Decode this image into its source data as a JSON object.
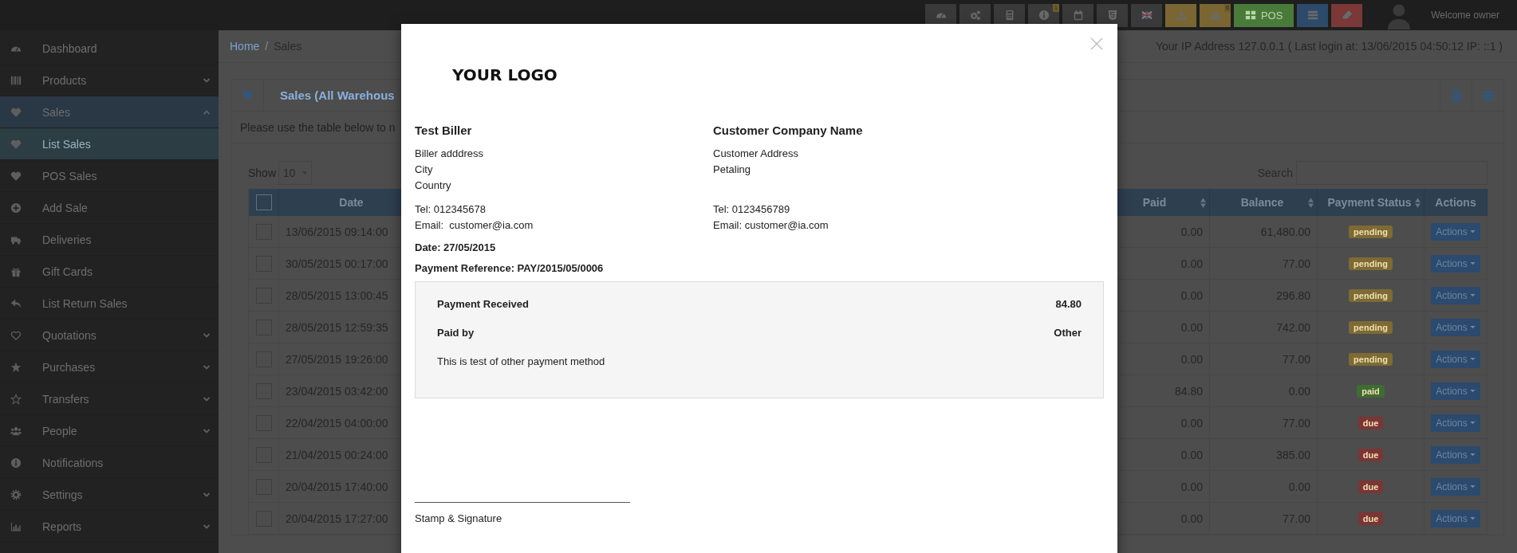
{
  "topbar": {
    "buttons": [
      {
        "color": "#3a3a3a"
      },
      {
        "color": "#3a3a3a"
      },
      {
        "color": "#3a3a3a"
      },
      {
        "color": "#3a3a3a",
        "badge": "1"
      },
      {
        "color": "#3a3a3a"
      },
      {
        "color": "#3a3a3a"
      },
      {
        "color": "#3a3a3a"
      },
      {
        "color": "#7a6633"
      },
      {
        "color": "#7a6633",
        "badge": "6"
      },
      {
        "color": "#4a7a3a",
        "label": "POS"
      },
      {
        "color": "#2e4a6a"
      },
      {
        "color": "#7a3838"
      }
    ],
    "welcome": "Welcome owner"
  },
  "sidebar": {
    "items": [
      {
        "label": "Dashboard",
        "selected": false
      },
      {
        "label": "Products",
        "selected": false,
        "expanded": false
      },
      {
        "label": "Sales",
        "selected": true,
        "expanded": true,
        "children": [
          {
            "label": "List Sales",
            "selected": true
          },
          {
            "label": "POS Sales",
            "selected": false
          },
          {
            "label": "Add Sale",
            "selected": false
          },
          {
            "label": "Deliveries",
            "selected": false
          },
          {
            "label": "Gift Cards",
            "selected": false
          },
          {
            "label": "List Return Sales",
            "selected": false
          }
        ]
      },
      {
        "label": "Quotations",
        "selected": false,
        "expanded": false
      },
      {
        "label": "Purchases",
        "selected": false,
        "expanded": false
      },
      {
        "label": "Transfers",
        "selected": false,
        "expanded": false
      },
      {
        "label": "People",
        "selected": false,
        "expanded": false
      },
      {
        "label": "Notifications",
        "selected": false
      },
      {
        "label": "Settings",
        "selected": false,
        "expanded": false
      },
      {
        "label": "Reports",
        "selected": false,
        "expanded": false
      }
    ]
  },
  "breadcrumb": {
    "items": [
      "Home",
      "Sales"
    ],
    "separator": "/"
  },
  "ip_info": "Your IP Address 127.0.0.1 ( Last login at: 13/06/2015 04:50:12 IP: ::1 )",
  "panel": {
    "title": "Sales (All Warehous",
    "intro": "Please use the table below to n"
  },
  "table": {
    "show_label": "Show",
    "page_size": "10",
    "search_label": "Search",
    "header_checked": false,
    "columns": [
      {
        "label": "Date",
        "sortable": false
      },
      {
        "label": "Paid",
        "sortable": true
      },
      {
        "label": "Balance",
        "sortable": true
      },
      {
        "label": "Payment Status",
        "sortable": true
      },
      {
        "label": "Actions",
        "sortable": false
      }
    ],
    "rows": [
      {
        "checked": false,
        "date": "13/06/2015 09:14:00",
        "paid": "0.00",
        "balance": "61,480.00",
        "status": {
          "label": "pending",
          "color": "#7d6a35"
        },
        "action": "Actions"
      },
      {
        "checked": false,
        "date": "30/05/2015 00:17:00",
        "paid": "0.00",
        "balance": "77.00",
        "status": {
          "label": "pending",
          "color": "#7d6a35"
        },
        "action": "Actions"
      },
      {
        "checked": false,
        "date": "28/05/2015 13:00:45",
        "paid": "0.00",
        "balance": "296.80",
        "status": {
          "label": "pending",
          "color": "#7d6a35"
        },
        "action": "Actions"
      },
      {
        "checked": false,
        "date": "28/05/2015 12:59:35",
        "paid": "0.00",
        "balance": "742.00",
        "status": {
          "label": "pending",
          "color": "#7d6a35"
        },
        "action": "Actions"
      },
      {
        "checked": false,
        "date": "27/05/2015 19:26:00",
        "paid": "0.00",
        "balance": "77.00",
        "status": {
          "label": "pending",
          "color": "#7d6a35"
        },
        "action": "Actions"
      },
      {
        "checked": false,
        "date": "23/04/2015 03:42:00",
        "paid": "84.80",
        "balance": "0.00",
        "status": {
          "label": "paid",
          "color": "#3f6b34"
        },
        "action": "Actions"
      },
      {
        "checked": false,
        "date": "22/04/2015 04:00:00",
        "paid": "0.00",
        "balance": "77.00",
        "status": {
          "label": "due",
          "color": "#7a3535"
        },
        "action": "Actions"
      },
      {
        "checked": false,
        "date": "21/04/2015 00:24:00",
        "paid": "0.00",
        "balance": "385.00",
        "status": {
          "label": "due",
          "color": "#7a3535"
        },
        "action": "Actions"
      },
      {
        "checked": false,
        "date": "20/04/2015 17:40:00",
        "paid": "0.00",
        "balance": "0.00",
        "status": {
          "label": "due",
          "color": "#7a3535"
        },
        "action": "Actions"
      },
      {
        "checked": false,
        "date": "20/04/2015 17:27:00",
        "paid": "0.00",
        "balance": "77.00",
        "status": {
          "label": "due",
          "color": "#7a3535"
        },
        "action": "Actions"
      }
    ]
  },
  "modal": {
    "logo": "YOUR LOGO",
    "biller": {
      "name": "Test Biller",
      "lines": [
        "Biller adddress",
        "City",
        "Country"
      ],
      "tel": "Tel: 012345678",
      "email": "Email:  customer@ia.com"
    },
    "customer": {
      "name": "Customer Company Name",
      "lines": [
        "Customer Address",
        "Petaling"
      ],
      "tel": "Tel: 0123456789",
      "email": "Email: customer@ia.com"
    },
    "date": "Date: 27/05/2015",
    "reference": "Payment Reference: PAY/2015/05/0006",
    "payment": {
      "rows": [
        {
          "label": "Payment Received",
          "value": "84.80"
        },
        {
          "label": "Paid by",
          "value": "Other"
        }
      ],
      "note": "This is test of other payment method"
    },
    "signature": "Stamp & Signature"
  }
}
